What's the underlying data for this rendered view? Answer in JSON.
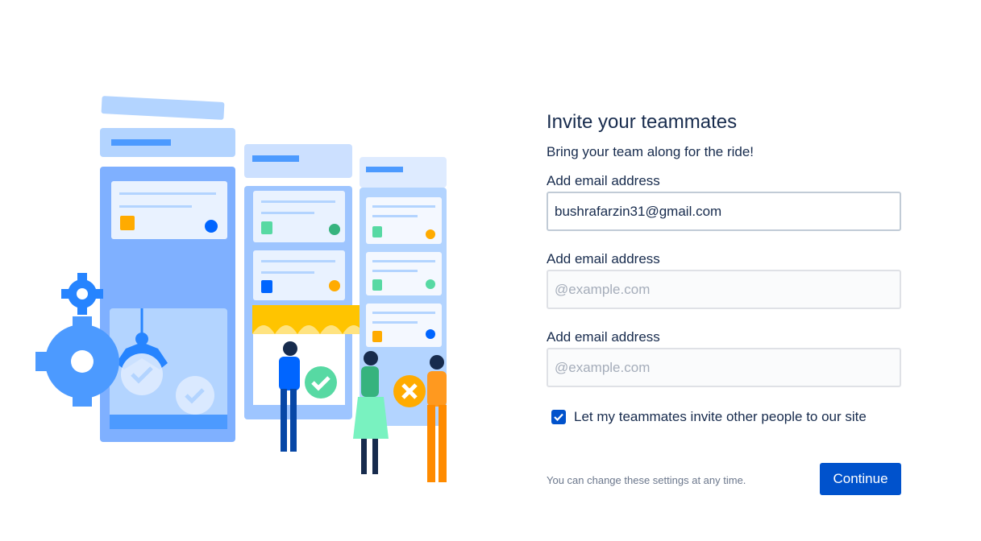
{
  "form": {
    "title": "Invite your teammates",
    "subtitle": "Bring your team along for the ride!",
    "fields": [
      {
        "label": "Add email address",
        "value": "bushrafarzin31@gmail.com",
        "placeholder": "@example.com"
      },
      {
        "label": "Add email address",
        "value": "",
        "placeholder": "@example.com"
      },
      {
        "label": "Add email address",
        "value": "",
        "placeholder": "@example.com"
      }
    ],
    "checkbox": {
      "label": "Let my teammates invite other people to our site",
      "checked": true
    }
  },
  "footer": {
    "note": "You can change these settings at any time.",
    "continue_label": "Continue"
  },
  "colors": {
    "primary": "#0052cc",
    "text": "#172b4d",
    "muted": "#6b778c"
  }
}
